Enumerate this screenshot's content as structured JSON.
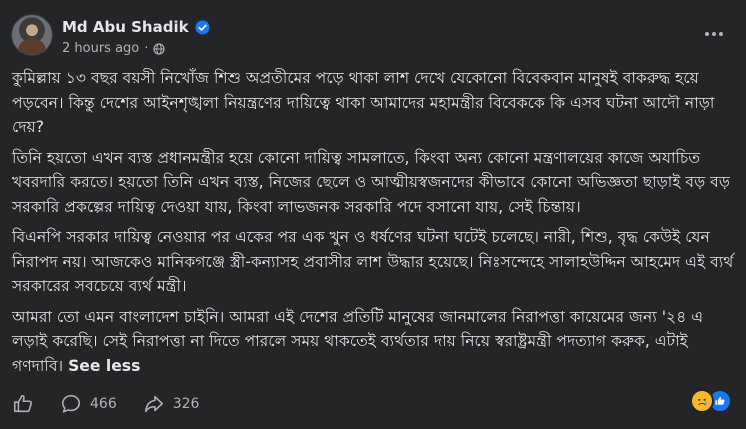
{
  "post": {
    "author": "Md Abu Shadik",
    "time": "2 hours ago",
    "separator": "·",
    "verified_icon": "verified-badge-icon",
    "audience_icon": "globe-icon",
    "paragraphs": [
      "কুমিল্লায় ১৩ বছর বয়সী নিখোঁজ শিশু অপ্রতীমের পড়ে থাকা লাশ দেখে যেকোনো বিবেকবান মানুষই বাকরুদ্ধ হয়ে পড়বেন। কিন্তু দেশের আইনশৃঙ্খলা নিয়ন্ত্রণের দায়িত্বে থাকা আমাদের মহামন্ত্রীর বিবেককে কি এসব ঘটনা আদৌ নাড়া দেয়?",
      "তিনি হয়তো এখন ব্যস্ত প্রধানমন্ত্রীর হয়ে কোনো দায়িত্ব সামলাতে, কিংবা অন্য কোনো মন্ত্রণালয়ের কাজে অযাচিত খবরদারি করতে। হয়তো তিনি এখন ব্যস্ত, নিজের ছেলে ও আত্মীয়স্বজনদের কীভাবে কোনো অভিজ্ঞতা ছাড়াই বড় বড় সরকারি প্রকল্পের দায়িত্ব দেওয়া যায়, কিংবা লাভজনক সরকারি পদে বসানো যায়, সেই চিন্তায়।",
      "বিএনপি সরকার দায়িত্ব নেওয়ার পর একের পর এক খুন ও ধর্ষণের ঘটনা ঘটেই চলেছে। নারী, শিশু, বৃদ্ধ কেউই যেন নিরাপদ নয়। আজকেও মানিকগঞ্জে স্ত্রী-কন্যাসহ প্রবাসীর লাশ উদ্ধার হয়েছে। নিঃসন্দেহে সালাহউদ্দিন আহমেদ এই ব্যর্থ সরকারের সবচেয়ে ব্যর্থ মন্ত্রী।",
      "আমরা তো এমন বাংলাদেশ চাইনি। আমরা এই দেশের প্রতিটি মানুষের জানমালের নিরাপত্তা কায়েমের জন্য '২৪ এ লড়াই করেছি। সেই নিরাপত্তা না দিতে পারলে সময় থাকতেই ব্যর্থতার দায় নিয়ে স্বরাষ্ট্রমন্ত্রী পদত্যাগ করুক, এটাই গণদাবি।"
    ],
    "see_less": "See less"
  },
  "actions": {
    "comments": "466",
    "shares": "326"
  },
  "reactions": [
    "sad",
    "like"
  ],
  "colors": {
    "background": "#242526",
    "text": "#e4e6eb",
    "secondary": "#b0b3b8",
    "accent": "#1877f2"
  }
}
